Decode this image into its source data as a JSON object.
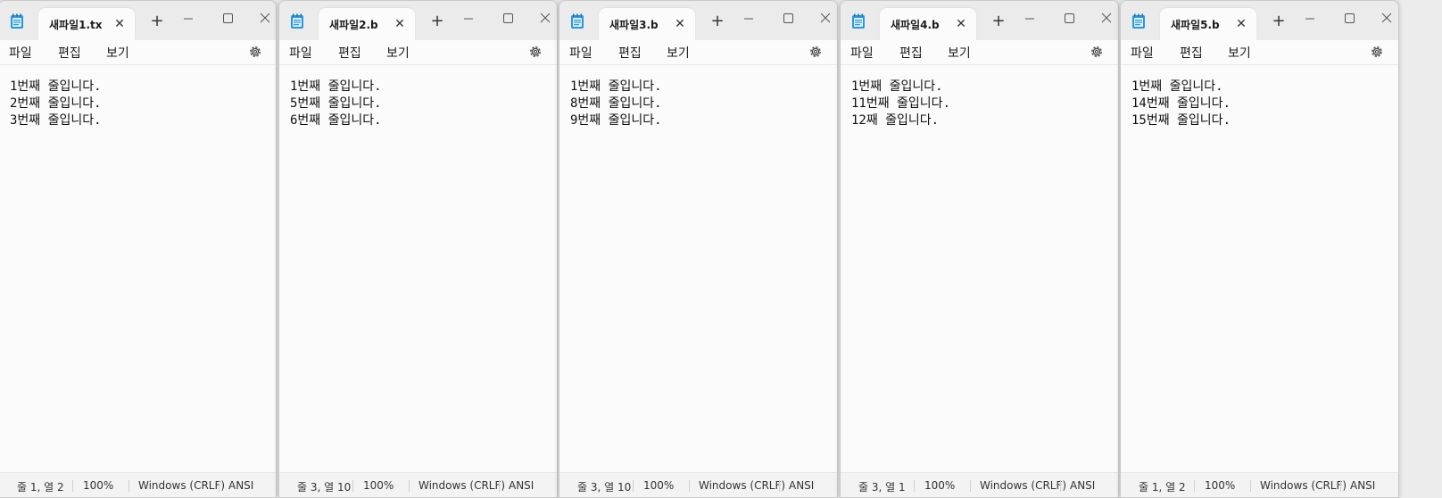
{
  "windows": [
    {
      "tab_title": "새파일1.tx",
      "menu": [
        "파일",
        "편집",
        "보기"
      ],
      "lines": [
        "1번째 줄입니다.",
        "2번째 줄입니다.",
        "3번째 줄입니다."
      ],
      "status": {
        "position": "줄 1, 열 2",
        "zoom": "100%",
        "eol": "Windows (CRLF)",
        "encoding": "ANSI"
      }
    },
    {
      "tab_title": "새파일2.b",
      "menu": [
        "파일",
        "편집",
        "보기"
      ],
      "lines": [
        "1번째 줄입니다.",
        "5번째 줄입니다.",
        "6번째 줄입니다."
      ],
      "status": {
        "position": "줄 3, 열 10",
        "zoom": "100%",
        "eol": "Windows (CRLF)",
        "encoding": "ANSI"
      }
    },
    {
      "tab_title": "새파일3.b",
      "menu": [
        "파일",
        "편집",
        "보기"
      ],
      "lines": [
        "1번째 줄입니다.",
        "8번째 줄입니다.",
        "9번째 줄입니다."
      ],
      "status": {
        "position": "줄 3, 열 10",
        "zoom": "100%",
        "eol": "Windows (CRLF)",
        "encoding": "ANSI"
      }
    },
    {
      "tab_title": "새파일4.b",
      "menu": [
        "파일",
        "편집",
        "보기"
      ],
      "lines": [
        "1번째 줄입니다.",
        "11번째 줄입니다.",
        "12째 줄입니다."
      ],
      "status": {
        "position": "줄 3, 열 1",
        "zoom": "100%",
        "eol": "Windows (CRLF)",
        "encoding": "ANSI"
      }
    },
    {
      "tab_title": "새파일5.b",
      "menu": [
        "파일",
        "편집",
        "보기"
      ],
      "lines": [
        "1번째 줄입니다.",
        "14번째 줄입니다.",
        "15번째 줄입니다."
      ],
      "status": {
        "position": "줄 1, 열 2",
        "zoom": "100%",
        "eol": "Windows (CRLF)",
        "encoding": "ANSI"
      }
    }
  ],
  "icons": {
    "app": "notepad-icon",
    "tab_close": "close-icon",
    "new_tab": "plus-icon",
    "minimize": "minimize-icon",
    "maximize": "maximize-icon",
    "close": "close-icon",
    "settings": "gear-icon"
  },
  "colors": {
    "titlebar": "#ebebeb",
    "editor_bg": "#fbfbfb",
    "statusbar": "#f3f3f3",
    "app_icon": "#1f8fd6"
  }
}
